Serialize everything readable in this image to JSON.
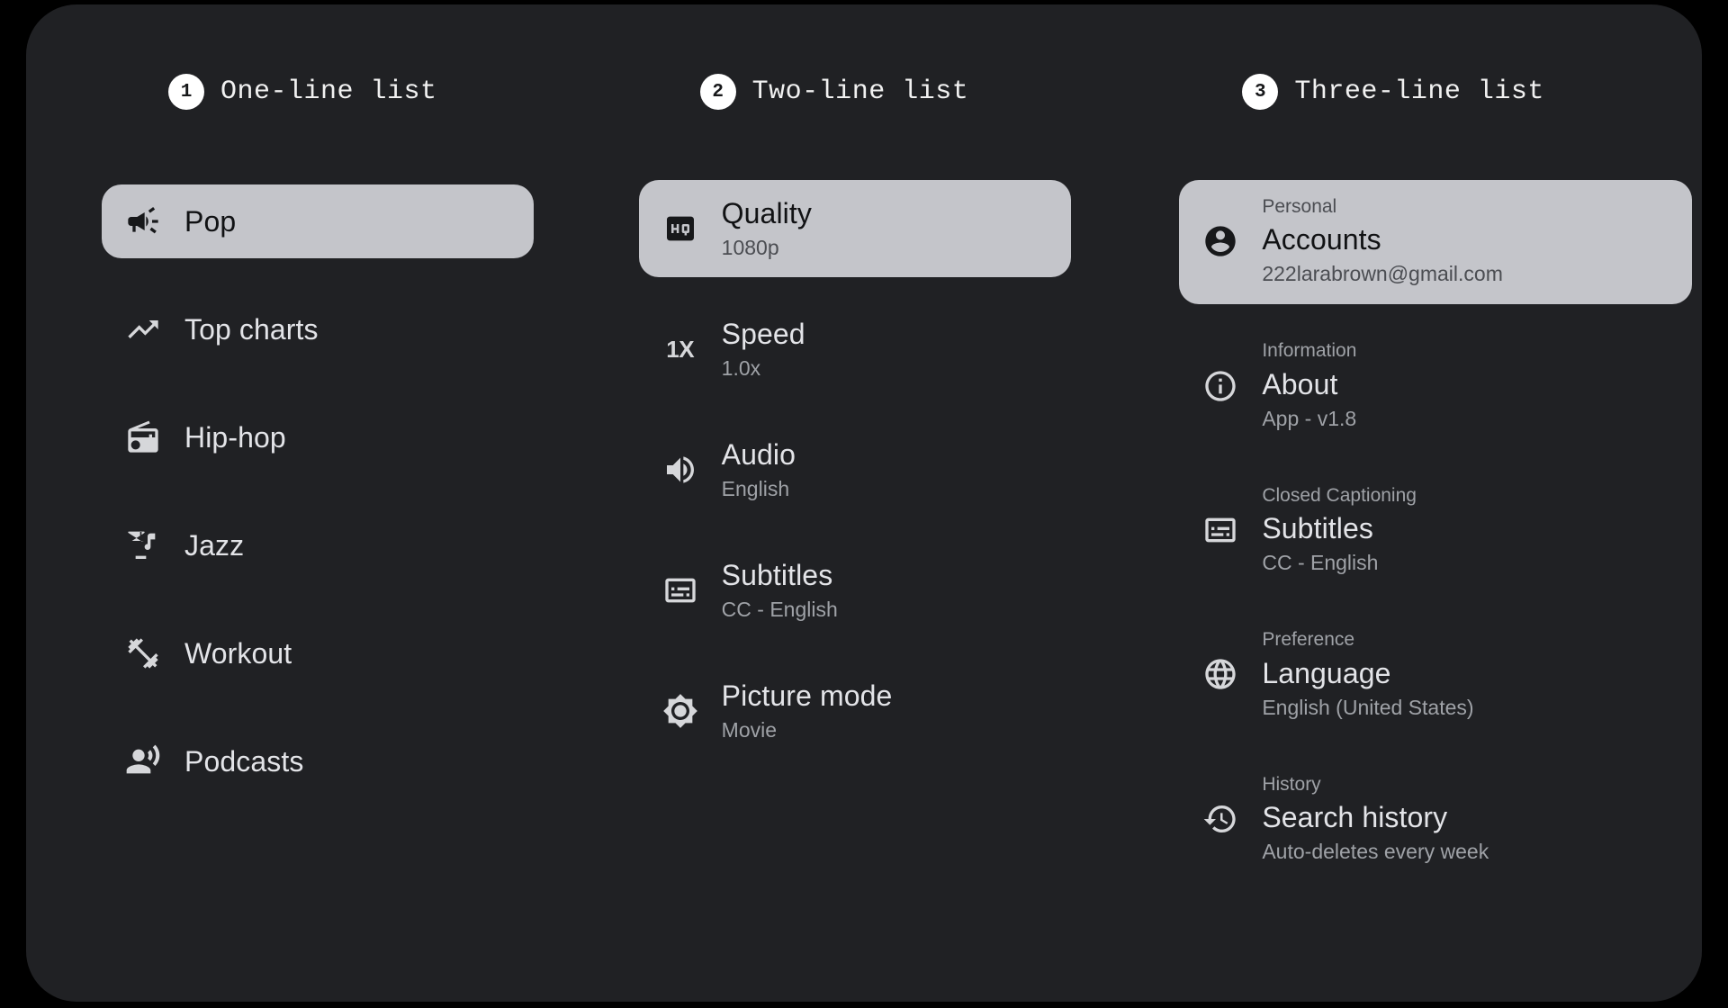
{
  "theme": {
    "page_background": "#000000",
    "card_background": "#202124",
    "selected_background": "#c4c5ca",
    "headline_color": "#e3e4e8",
    "support_color": "#9fa2a7",
    "badge_background": "#ffffff"
  },
  "columns": [
    {
      "number": "1",
      "title": "One-line list",
      "variant": "one-line",
      "items": [
        {
          "icon": "campaign-icon",
          "headline": "Pop",
          "selected": true
        },
        {
          "icon": "trending-up-icon",
          "headline": "Top charts",
          "selected": false
        },
        {
          "icon": "radio-icon",
          "headline": "Hip-hop",
          "selected": false
        },
        {
          "icon": "nightlife-icon",
          "headline": "Jazz",
          "selected": false
        },
        {
          "icon": "fitness-center-icon",
          "headline": "Workout",
          "selected": false
        },
        {
          "icon": "podcasts-icon",
          "headline": "Podcasts",
          "selected": false
        }
      ]
    },
    {
      "number": "2",
      "title": "Two-line list",
      "variant": "two-line",
      "items": [
        {
          "icon": "high-quality-icon",
          "headline": "Quality",
          "support": "1080p",
          "selected": true
        },
        {
          "icon": "speed-1x-icon",
          "icon_label": "1X",
          "headline": "Speed",
          "support": "1.0x",
          "selected": false
        },
        {
          "icon": "volume-up-icon",
          "headline": "Audio",
          "support": "English",
          "selected": false
        },
        {
          "icon": "closed-caption-icon",
          "headline": "Subtitles",
          "support": "CC - English",
          "selected": false
        },
        {
          "icon": "brightness-icon",
          "headline": "Picture mode",
          "support": "Movie",
          "selected": false
        }
      ]
    },
    {
      "number": "3",
      "title": "Three-line list",
      "variant": "three-line",
      "items": [
        {
          "icon": "account-circle-icon",
          "overline": "Personal",
          "headline": "Accounts",
          "support": "222larabrown@gmail.com",
          "selected": true
        },
        {
          "icon": "info-icon",
          "overline": "Information",
          "headline": "About",
          "support": "App - v1.8",
          "selected": false
        },
        {
          "icon": "closed-caption-icon",
          "overline": "Closed Captioning",
          "headline": "Subtitles",
          "support": "CC - English",
          "selected": false
        },
        {
          "icon": "language-globe-icon",
          "overline": "Preference",
          "headline": "Language",
          "support": "English (United States)",
          "selected": false
        },
        {
          "icon": "history-icon",
          "overline": "History",
          "headline": "Search history",
          "support": "Auto-deletes every week",
          "selected": false
        }
      ]
    }
  ]
}
